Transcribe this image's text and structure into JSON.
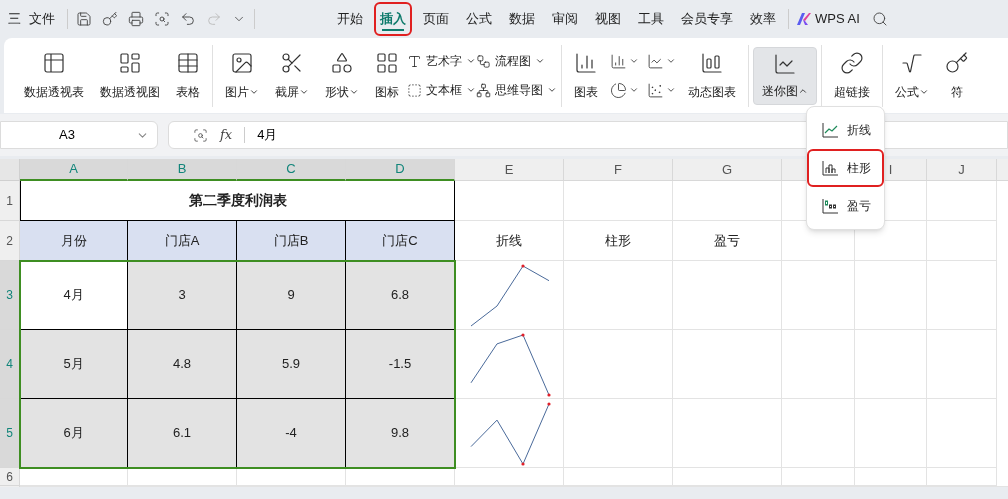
{
  "quick_access": {
    "menu_icon": "三",
    "file_menu": "文件"
  },
  "tabs": [
    {
      "label": "开始",
      "selected": false,
      "highlighted": false
    },
    {
      "label": "插入",
      "selected": true,
      "highlighted": true
    },
    {
      "label": "页面",
      "selected": false,
      "highlighted": false
    },
    {
      "label": "公式",
      "selected": false,
      "highlighted": false
    },
    {
      "label": "数据",
      "selected": false,
      "highlighted": false
    },
    {
      "label": "审阅",
      "selected": false,
      "highlighted": false
    },
    {
      "label": "视图",
      "selected": false,
      "highlighted": false
    },
    {
      "label": "工具",
      "selected": false,
      "highlighted": false
    },
    {
      "label": "会员专享",
      "selected": false,
      "highlighted": false
    },
    {
      "label": "效率",
      "selected": false,
      "highlighted": false
    }
  ],
  "ai_button": "WPS AI",
  "ribbon_groups": [
    {
      "items": [
        {
          "kind": "large",
          "label": "数据透视表",
          "dropdown": false,
          "pressed": false
        },
        {
          "kind": "large",
          "label": "数据透视图",
          "dropdown": false,
          "pressed": false
        },
        {
          "kind": "large",
          "label": "表格",
          "dropdown": false,
          "pressed": false
        }
      ]
    },
    {
      "items": [
        {
          "kind": "large",
          "label": "图片",
          "dropdown": true,
          "pressed": false
        },
        {
          "kind": "large",
          "label": "截屏",
          "dropdown": true,
          "pressed": false
        },
        {
          "kind": "large",
          "label": "形状",
          "dropdown": true,
          "pressed": false
        },
        {
          "kind": "large",
          "label": "图标",
          "dropdown": false,
          "pressed": false
        },
        {
          "kind": "stack",
          "top": "艺术字",
          "bottom": "文本框"
        },
        {
          "kind": "stack",
          "top": "流程图",
          "bottom": "思维导图"
        }
      ]
    },
    {
      "items": [
        {
          "kind": "large",
          "label": "图表",
          "dropdown": false,
          "pressed": false
        },
        {
          "kind": "icons"
        },
        {
          "kind": "icons"
        },
        {
          "kind": "large",
          "label": "动态图表",
          "dropdown": false,
          "pressed": false
        }
      ]
    },
    {
      "items": [
        {
          "kind": "large",
          "label": "迷你图",
          "dropdown": true,
          "pressed": true
        }
      ]
    },
    {
      "items": [
        {
          "kind": "large",
          "label": "超链接",
          "dropdown": false,
          "pressed": false
        }
      ]
    },
    {
      "items": [
        {
          "kind": "large",
          "label": "公式",
          "dropdown": true,
          "pressed": false
        },
        {
          "kind": "large",
          "label": "符",
          "dropdown": false,
          "pressed": false
        }
      ]
    }
  ],
  "formula_bar": {
    "name_box": "A3",
    "fx": "fx",
    "value": "4月"
  },
  "sheet": {
    "columns": [
      {
        "label": "A",
        "selected": true
      },
      {
        "label": "B",
        "selected": true
      },
      {
        "label": "C",
        "selected": true
      },
      {
        "label": "D",
        "selected": true
      },
      {
        "label": "E",
        "selected": false
      },
      {
        "label": "F",
        "selected": false
      },
      {
        "label": "G",
        "selected": false
      },
      {
        "selected": false
      },
      {
        "label": "I",
        "selected": false
      },
      {
        "label": "J",
        "selected": false
      }
    ],
    "title": "第二季度利润表",
    "header": [
      "月份",
      "门店A",
      "门店B",
      "门店C"
    ],
    "sparkline_labels": [
      "折线",
      "柱形",
      "盈亏"
    ],
    "rows": [
      {
        "cells": [
          {
            "text": "4月",
            "active": true
          },
          {
            "text": "3",
            "active": false
          },
          {
            "text": "9",
            "active": false
          },
          {
            "text": "6.8",
            "active": false
          }
        ]
      },
      {
        "cells": [
          {
            "text": "5月",
            "active": false
          },
          {
            "text": "4.8",
            "active": false
          },
          {
            "text": "5.9",
            "active": false
          },
          {
            "text": "-1.5",
            "active": false
          }
        ]
      },
      {
        "cells": [
          {
            "text": "6月",
            "active": false
          },
          {
            "text": "6.1",
            "active": false
          },
          {
            "text": "-4",
            "active": false
          },
          {
            "text": "9.8",
            "active": false
          }
        ]
      }
    ],
    "row_headers": [
      {
        "label": "1",
        "selected": false
      },
      {
        "label": "2",
        "selected": false
      },
      {
        "label": "3",
        "selected": true
      },
      {
        "label": "4",
        "selected": true
      },
      {
        "label": "5",
        "selected": true
      },
      {
        "label": "6",
        "selected": false
      }
    ]
  },
  "sparkline_menu": [
    {
      "label": "折线",
      "kind": "line",
      "highlighted": false
    },
    {
      "label": "柱形",
      "kind": "column",
      "highlighted": true
    },
    {
      "label": "盈亏",
      "kind": "winloss",
      "highlighted": false
    }
  ]
}
